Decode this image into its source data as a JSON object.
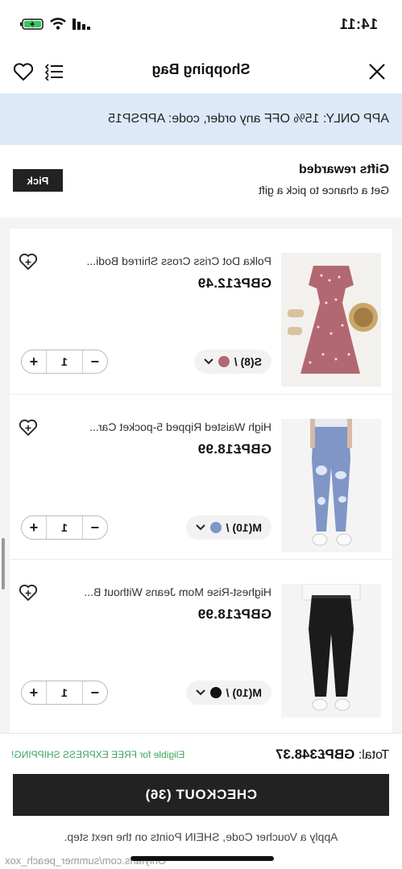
{
  "status_bar": {
    "time": "14:11"
  },
  "header": {
    "title": "Shopping Bag"
  },
  "promo": {
    "text": "APP ONLY: 15% OFF any order, code: APPSP15"
  },
  "gifts": {
    "title": "Gifts rewarded",
    "subtitle": "Get a chance to pick a gift",
    "button": "Pick"
  },
  "items": [
    {
      "name": "Polka Dot Criss Cross Shirred Bodi...",
      "price": "GBP£12.49",
      "variant": "S(8) /",
      "quantity": "1",
      "swatch_color": "#b26870"
    },
    {
      "name": "High Waisted Ripped 5-pocket Car...",
      "price": "GBP£18.99",
      "variant": "M(10) /",
      "quantity": "1",
      "swatch_color": "#7f96c6"
    },
    {
      "name": "Highest-Rise Mom Jeans Without B...",
      "price": "GBP£18.99",
      "variant": "M(10) /",
      "quantity": "1",
      "swatch_color": "#111111"
    }
  ],
  "footer": {
    "total_label": "Total:",
    "total_value": "GBP£348.37",
    "free_shipping": "Eligible for FREE EXPRESS SHIPPING!",
    "checkout": "CHECKOUT (36)",
    "apply_note": "Apply a Voucher Code, SHEIN Points on the next step.",
    "watermark": "Onlyfans.com/summer_peach_xox"
  },
  "colors": {
    "promo_bg": "#dde9f8",
    "checkout_bg": "#222222",
    "free_shipping": "#3aa35a"
  }
}
